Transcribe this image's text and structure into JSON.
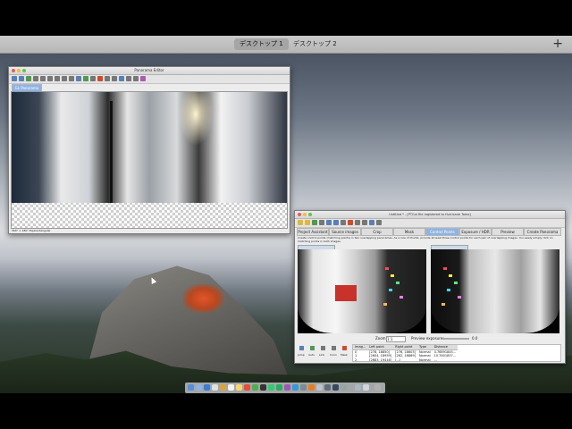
{
  "spaces": {
    "tabs": [
      {
        "label": "デスクトップ 1",
        "active": true
      },
      {
        "label": "デスクトップ 2",
        "active": false
      }
    ],
    "add_label": "+"
  },
  "panorama_editor": {
    "title": "Panorama Editor",
    "tab": "GL Panorama"
  },
  "hugin": {
    "title": "Untitled * - [PTGui file registered to Hurricane Tomo]",
    "tabs": [
      {
        "label": "Project Assistant",
        "active": false
      },
      {
        "label": "Source images",
        "active": false
      },
      {
        "label": "Crop",
        "active": false
      },
      {
        "label": "Mask",
        "active": false
      },
      {
        "label": "Control Points",
        "active": true
      },
      {
        "label": "Exposure / HDR",
        "active": false
      },
      {
        "label": "Preview",
        "active": false
      },
      {
        "label": "Create Panorama",
        "active": false
      }
    ],
    "help_text": "Create control points (matching points) in two overlapping panoramas. As a rule of thumb, provide at least three control points for each pair of overlapping images. You easily simply click on matching points in both images.",
    "zoom_label": "Zoom:",
    "zoom_value": "1:1",
    "preview_label": "Preview exposure:",
    "preview_value": "0.0",
    "buttons": [
      {
        "label": "Jump",
        "icon": "jump-icon"
      },
      {
        "label": "Auto",
        "icon": "auto-icon"
      },
      {
        "label": "Link",
        "icon": "link-icon"
      },
      {
        "label": "Conn",
        "icon": "connect-icon"
      },
      {
        "label": "Mask",
        "icon": "mask-icon"
      }
    ],
    "table": {
      "headers": [
        "Imag...",
        "Left point",
        "Right point",
        "Type",
        "Distance"
      ],
      "rows": [
        [
          "0",
          "[278, 18850]",
          "[276, 18603]",
          "Normal",
          "4.76891845..."
        ],
        [
          "1",
          "[2604, 18959]",
          "[282, 18869]",
          "Normal",
          "10.7601837..."
        ],
        [
          "2",
          "[2683, 19416]",
          "[...]",
          "Normal",
          "..."
        ]
      ]
    }
  },
  "colors": {
    "active_tab": "#8cb3e8",
    "accent_red": "#d24a2a"
  }
}
